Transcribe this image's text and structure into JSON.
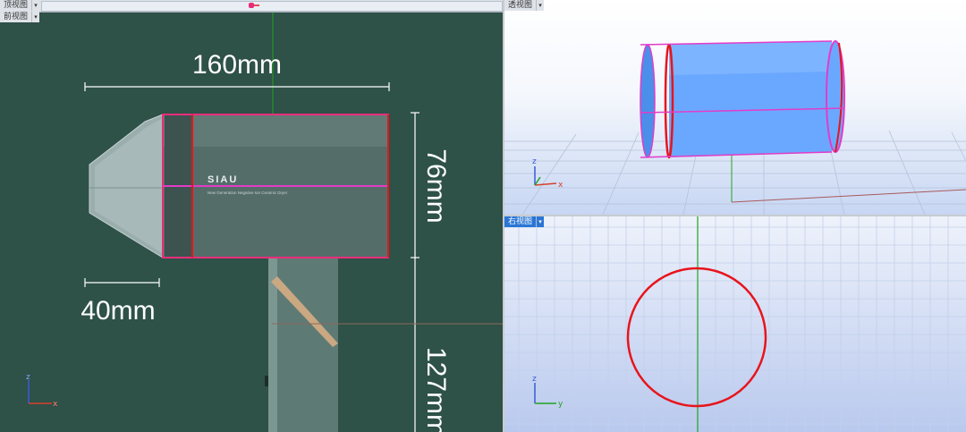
{
  "viewports": {
    "top": {
      "label": "顶视图"
    },
    "front": {
      "label": "前视图"
    },
    "perspective": {
      "label": "透视图"
    },
    "right": {
      "label": "右视图"
    }
  },
  "dimensions": {
    "width": "160mm",
    "nozzle": "40mm",
    "diameter": "76mm",
    "handle": "127mm"
  },
  "product": {
    "brand": "SIAU",
    "tagline": "New Generation Negative Ion Ceramic Dryer"
  },
  "axes": {
    "x": "x",
    "y": "y",
    "z": "z"
  },
  "colors": {
    "front_bg": "#2e5148",
    "outline_red": "#e8141c",
    "outline_magenta": "#e23cc8",
    "axis_green": "#22a322",
    "cylinder_blue": "#6aa8ff"
  }
}
